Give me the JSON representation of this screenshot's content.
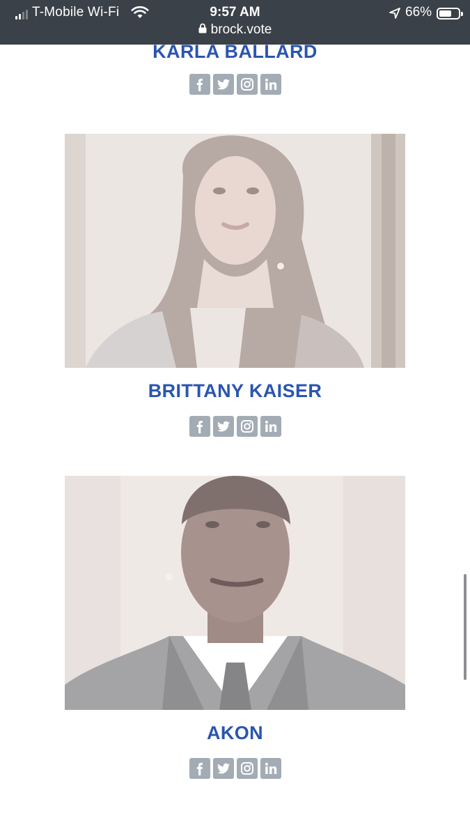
{
  "status_bar": {
    "carrier": "T-Mobile Wi-Fi",
    "time": "9:57 AM",
    "battery_percent": "66%",
    "battery_level": 0.66,
    "signal_bars_active": 2,
    "icons": [
      "signal-icon",
      "wifi-icon",
      "location-arrow-icon",
      "battery-icon",
      "lock-icon"
    ]
  },
  "browser": {
    "url": "brock.vote"
  },
  "people": [
    {
      "name": "KARLA BALLARD",
      "social": [
        "facebook-icon",
        "twitter-icon",
        "instagram-icon",
        "linkedin-icon"
      ]
    },
    {
      "name": "BRITTANY KAISER",
      "photo": "brittany-kaiser-photo",
      "social": [
        "facebook-icon",
        "twitter-icon",
        "instagram-icon",
        "linkedin-icon"
      ]
    },
    {
      "name": "AKON",
      "photo": "akon-photo",
      "social": [
        "facebook-icon",
        "twitter-icon",
        "instagram-icon",
        "linkedin-icon"
      ]
    }
  ],
  "colors": {
    "name_blue": "#2a55b0",
    "social_gray": "#a3abb5",
    "status_bar_bg": "#3a4148"
  }
}
